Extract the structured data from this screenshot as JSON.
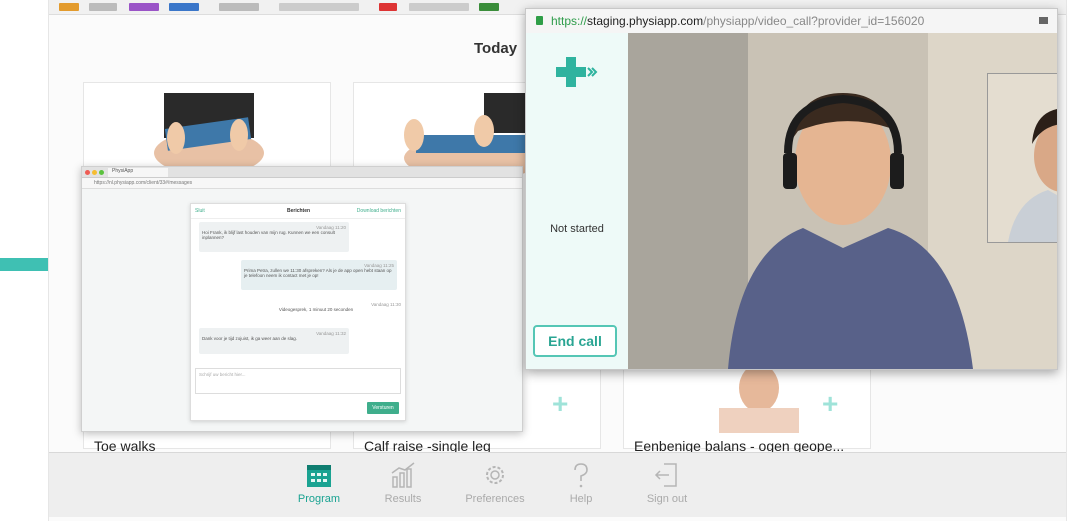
{
  "page": {
    "today_label": "Today"
  },
  "cards": [
    {
      "title": "Toe walks"
    },
    {
      "title": "Calf raise -single leg"
    },
    {
      "title": "Eenbenige balans - ogen geope..."
    }
  ],
  "nav": {
    "items": [
      {
        "label": "Program",
        "icon": "calendar-icon",
        "active": true
      },
      {
        "label": "Results",
        "icon": "bar-chart-icon",
        "active": false
      },
      {
        "label": "Preferences",
        "icon": "gear-icon",
        "active": false
      },
      {
        "label": "Help",
        "icon": "question-icon",
        "active": false
      },
      {
        "label": "Sign out",
        "icon": "sign-out-icon",
        "active": false
      }
    ]
  },
  "video_call": {
    "url_scheme": "https://",
    "url_host": "staging.physiapp.com",
    "url_path": "/physiapp/video_call?provider_id=156020",
    "status": "Not started",
    "end_call_label": "End call"
  },
  "chat": {
    "tab_title": "PhysiApp",
    "url": "https://nl.physiapp.com/client/33#/messages",
    "header_left": "Sluit",
    "header_title": "Berichten",
    "header_right": "Download berichten",
    "messages": [
      {
        "time": "Vandaag 11:20",
        "text": "Hoi Frank, ik blijf last houden van mijn rug. Kunnen we een consult inplannen?"
      },
      {
        "time": "Vandaag 11:25",
        "text": "Prima Petra, zullen we 11:30 afspreken? Als je de app open hebt staan op je telefoon neem ik contact met je op!"
      },
      {
        "time": "Vandaag 11:30",
        "text": "Videogesprek, 1 minuut 20 seconden"
      },
      {
        "time": "Vandaag 11:32",
        "text": "Dank voor je tijd zojuist, ik ga weer aan de slag."
      }
    ],
    "input_placeholder": "Schrijf uw bericht hier...",
    "send_label": "Versturen"
  },
  "colors": {
    "accent": "#3fc0b3",
    "active_nav": "#1aa392",
    "end_call_border": "#55c6b5"
  }
}
